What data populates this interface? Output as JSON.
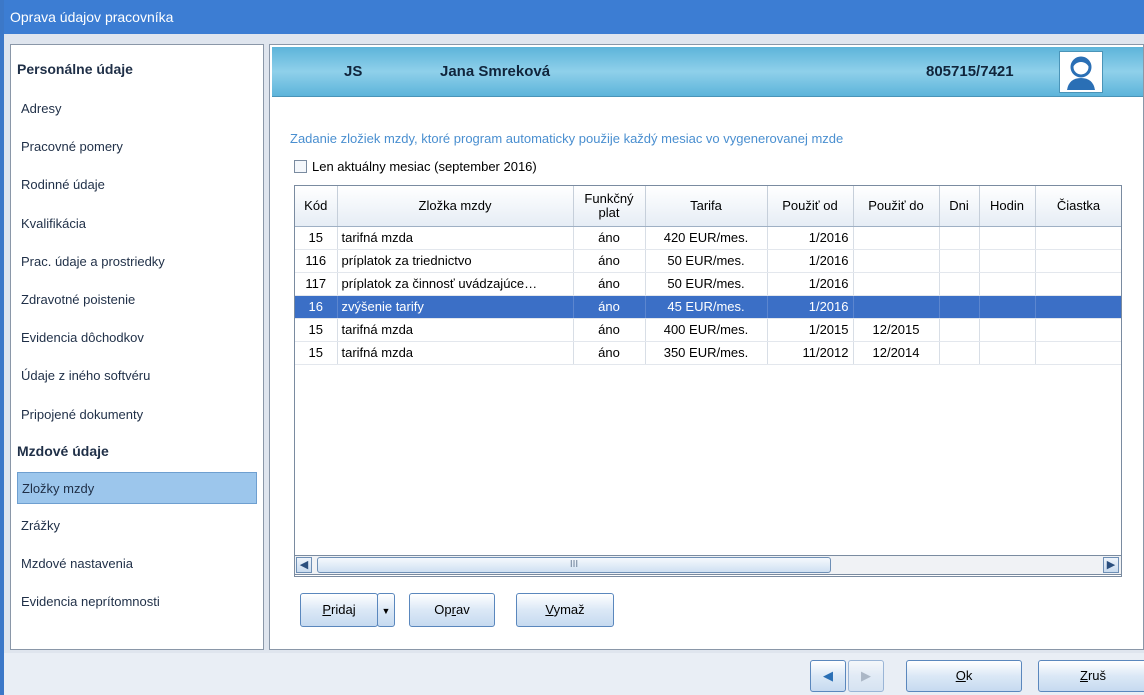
{
  "window": {
    "title": "Oprava údajov pracovníka"
  },
  "sidebar": {
    "section1": "Personálne údaje",
    "items1": [
      "Adresy",
      "Pracovné pomery",
      "Rodinné údaje",
      "Kvalifikácia",
      "Prac. údaje a prostriedky",
      "Zdravotné poistenie",
      "Evidencia dôchodkov",
      "Údaje z iného softvéru",
      "Pripojené dokumenty"
    ],
    "section2": "Mzdové údaje",
    "items2": [
      "Zložky mzdy",
      "Zrážky",
      "Mzdové nastavenia",
      "Evidencia neprítomnosti"
    ],
    "active": "Zložky mzdy"
  },
  "header": {
    "initials": "JS",
    "name": "Jana Smreková",
    "id": "805715/7421",
    "avatar_icon": "person-avatar-icon"
  },
  "hint": "Zadanie zložiek mzdy, ktoré program automaticky použije každý mesiac vo vygenerovanej mzde",
  "checkbox": {
    "label": "Len aktuálny mesiac (september 2016)",
    "checked": false
  },
  "table": {
    "columns": [
      "Kód",
      "Zložka mzdy",
      "Funkčný plat",
      "Tarifa",
      "Použiť od",
      "Použiť do",
      "Dni",
      "Hodin",
      "Čiastka"
    ],
    "rows": [
      [
        "15",
        "tarifná mzda",
        "áno",
        "420 EUR/mes.",
        "1/2016",
        "",
        "",
        "",
        ""
      ],
      [
        "116",
        "príplatok za triednictvo",
        "áno",
        "50 EUR/mes.",
        "1/2016",
        "",
        "",
        "",
        ""
      ],
      [
        "117",
        "príplatok za činnosť uvádzajúce…",
        "áno",
        "50 EUR/mes.",
        "1/2016",
        "",
        "",
        "",
        ""
      ],
      [
        "16",
        "zvýšenie tarify",
        "áno",
        "45 EUR/mes.",
        "1/2016",
        "",
        "",
        "",
        ""
      ],
      [
        "15",
        "tarifná mzda",
        "áno",
        "400 EUR/mes.",
        "1/2015",
        "12/2015",
        "",
        "",
        ""
      ],
      [
        "15",
        "tarifná mzda",
        "áno",
        "350 EUR/mes.",
        "11/2012",
        "12/2014",
        "",
        "",
        ""
      ]
    ],
    "selected_row": 3,
    "scroll_thumb_glyph": "III"
  },
  "buttons": {
    "add": "Pridaj",
    "add_p": "P",
    "add_rest": "ridaj",
    "edit": "Oprav",
    "edit_pre": "Op",
    "edit_u": "r",
    "edit_post": "av",
    "delete": "Vymaž",
    "del_u": "V",
    "del_rest": "ymaž"
  },
  "footer": {
    "ok_u": "O",
    "ok_rest": "k",
    "cancel_u": "Z",
    "cancel_rest": "ruš"
  },
  "colors": {
    "titlebar": "#3c7dd3",
    "selection": "#3b6fc6",
    "hint": "#4a8fd0",
    "header_band": "#5db4da"
  }
}
